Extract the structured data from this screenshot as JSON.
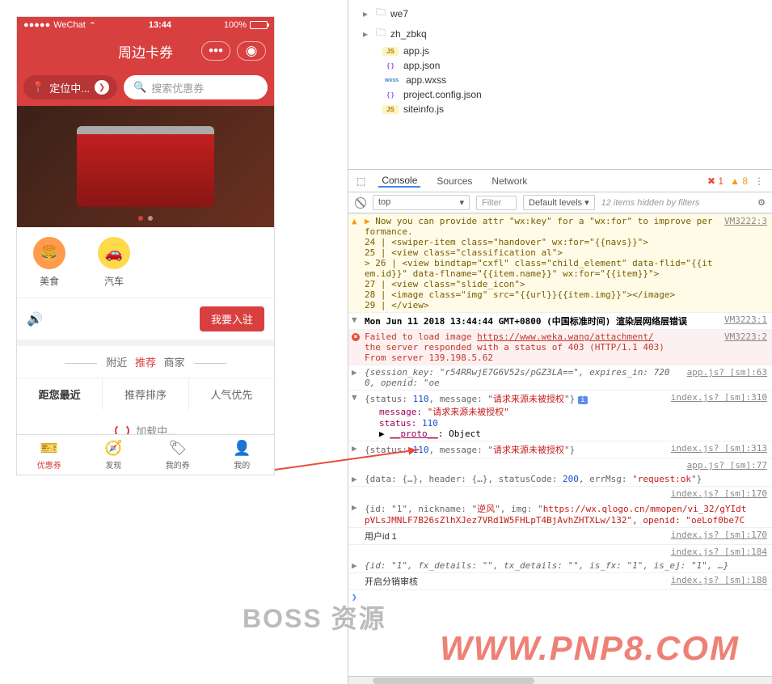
{
  "phone": {
    "status": {
      "carrier": "WeChat",
      "time": "13:44",
      "battery": "100%"
    },
    "nav": {
      "title": "周边卡券"
    },
    "search": {
      "location": "定位中...",
      "placeholder": "搜索优惠券"
    },
    "categories": [
      {
        "label": "美食",
        "icon": "🍔",
        "bg": "cat-food"
      },
      {
        "label": "汽车",
        "icon": "🚗",
        "bg": "cat-car"
      }
    ],
    "joinBtn": "我要入驻",
    "sectionTabs": {
      "nearby": "附近",
      "recommend": "推荐",
      "merchant": "商家"
    },
    "sortTabs": [
      {
        "label": "距您最近",
        "active": true
      },
      {
        "label": "推荐排序",
        "active": false
      },
      {
        "label": "人气优先",
        "active": false
      }
    ],
    "loading": "加载中...",
    "tabbar": [
      {
        "label": "优惠券",
        "active": true,
        "icon": "🎫"
      },
      {
        "label": "发现",
        "active": false,
        "icon": "🧭"
      },
      {
        "label": "我的券",
        "active": false,
        "icon": "🏷"
      },
      {
        "label": "我的",
        "active": false,
        "icon": "👤"
      }
    ]
  },
  "devtools": {
    "fileTree": [
      {
        "type": "folder",
        "name": "we7"
      },
      {
        "type": "folder",
        "name": "zh_zbkq"
      },
      {
        "type": "file",
        "name": "app.js",
        "badge": "JS",
        "badgeClass": "js-badge"
      },
      {
        "type": "file",
        "name": "app.json",
        "badge": "{ }",
        "badgeClass": "json-badge"
      },
      {
        "type": "file",
        "name": "app.wxss",
        "badge": "wxss",
        "badgeClass": "wxss-badge"
      },
      {
        "type": "file",
        "name": "project.config.json",
        "badge": "{ }",
        "badgeClass": "json-badge"
      },
      {
        "type": "file",
        "name": "siteinfo.js",
        "badge": "JS",
        "badgeClass": "js-badge"
      }
    ],
    "tabs": [
      "Console",
      "Sources",
      "Network"
    ],
    "errorCount": "1",
    "warnCount": "8",
    "context": "top",
    "filterPlaceholder": "Filter",
    "levels": "Default levels ▾",
    "hiddenMsg": "12 items hidden by filters",
    "logs": {
      "warn1_text": "Now you can provide attr \"wx:key\" for a \"wx:for\" to improve performance.",
      "warn1_src": "VM3222:3",
      "warn1_l24": "24 |               <swiper-item class=\"handover\" wx:for=\"{{navs}}\">",
      "warn1_l25": "25 |                 <view class=\"classification al\">",
      "warn1_l26": "> 26 |                   <view bindtap=\"cxfl\" class=\"child_element\" data-flid=\"{{item.id}}\" data-flname=\"{{item.name}}\" wx:for=\"{{item}}\">",
      "warn1_l27": "27 |                     <view class=\"slide_icon\">",
      "warn1_l28": "28 |                       <image class=\"img\" src=\"{{url}}{{item.img}}\"></image>",
      "warn1_l29": "29 |                     </view>",
      "err_block_title": "Mon Jun 11 2018 13:44:44 GMT+0800 (中国标准时间) 渲染层网络层错误",
      "err_block_src": "VM3223:1",
      "err_fail": "Failed to load image ",
      "err_url": "https://www.weka.wang/attachment/",
      "err_fail_src": "VM3223:2",
      "err_403": "the server responded with a status of 403 (HTTP/1.1 403)",
      "err_from": "From server 139.198.5.62",
      "sess_src": "app.js? [sm]:63",
      "sess_text_pre": "{session_key: \"r54RRwjE7G6V52s/pGZ3LA==\", expires_in: 7200, openid: \"oe",
      "s110_src": "index.js? [sm]:310",
      "s110_pre": "{status: ",
      "s110_num": "110",
      "s110_mid": ", message: \"",
      "s110_msg": "请求来源未被授权",
      "s110_end": "\"}",
      "s110_exp_msg_k": "message: ",
      "s110_exp_msg_v": "\"请求来源未被授权\"",
      "s110_exp_stat_k": "status: ",
      "s110_exp_stat_v": "110",
      "s110_proto": "__proto__",
      "s110_proto_v": ": Object",
      "s313_src": "index.js? [sm]:313",
      "app77_src": "app.js? [sm]:77",
      "reqok_pre": "{data: {…}, header: {…}, statusCode: ",
      "reqok_code": "200",
      "reqok_mid": ", errMsg: \"",
      "reqok_msg": "request:ok",
      "reqok_end": "\"}",
      "idx170_src": "index.js? [sm]:170",
      "nick_pre": "{id: \"1\", nickname: \"",
      "nick_name": "逆风",
      "nick_mid": "\", img: \"",
      "nick_img": "https://wx.qlogo.cn/mmopen/vi_32/gYIdt",
      "nick_line2": "pVLsJMNLF7B26sZlhXJez7VRd1W5FHLpT4BjAvhZHTXLw/132\", openid: \"oeLof0be7C",
      "userid": "用户id 1",
      "idx184_src": "index.js? [sm]:184",
      "fx_text": "{id: \"1\", fx_details: \"\", tx_details: \"\", is_fx: \"1\", is_ej: \"1\", …}",
      "idx188_src": "index.js? [sm]:188",
      "fenxiao": "开启分销审核"
    }
  },
  "watermark": "WWW.PNP8.COM",
  "bossWatermark": "BOSS 资源"
}
